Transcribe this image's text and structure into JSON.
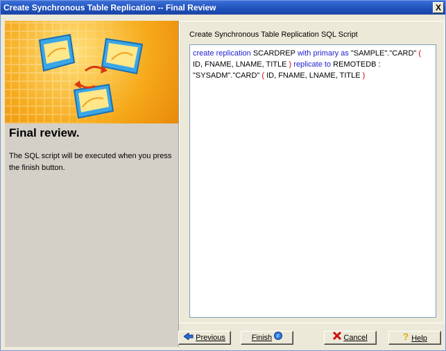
{
  "window": {
    "title": "Create Synchronous Table Replication -- Final Review",
    "close_label": "X"
  },
  "left": {
    "heading": "Final review.",
    "description": "The SQL script will be executed when you press the finish button."
  },
  "script": {
    "label": "Create Synchronous Table Replication SQL Script",
    "tokens": {
      "t1": "create replication",
      "t2": " SCARDREP ",
      "t3": "with primary as",
      "t4": " \"SAMPLE\".\"CARD\" ",
      "t5": "(",
      "t6": " ID, FNAME, LNAME, TITLE ",
      "t7": ")",
      "t8": " replicate to",
      "t9": " REMOTEDB : \"SYSADM\".\"CARD\" ",
      "t10": "(",
      "t11": " ID, FNAME, LNAME, TITLE ",
      "t12": ")"
    }
  },
  "buttons": {
    "previous": "Previous",
    "finish": "Finish",
    "cancel": "Cancel",
    "help": "Help"
  }
}
